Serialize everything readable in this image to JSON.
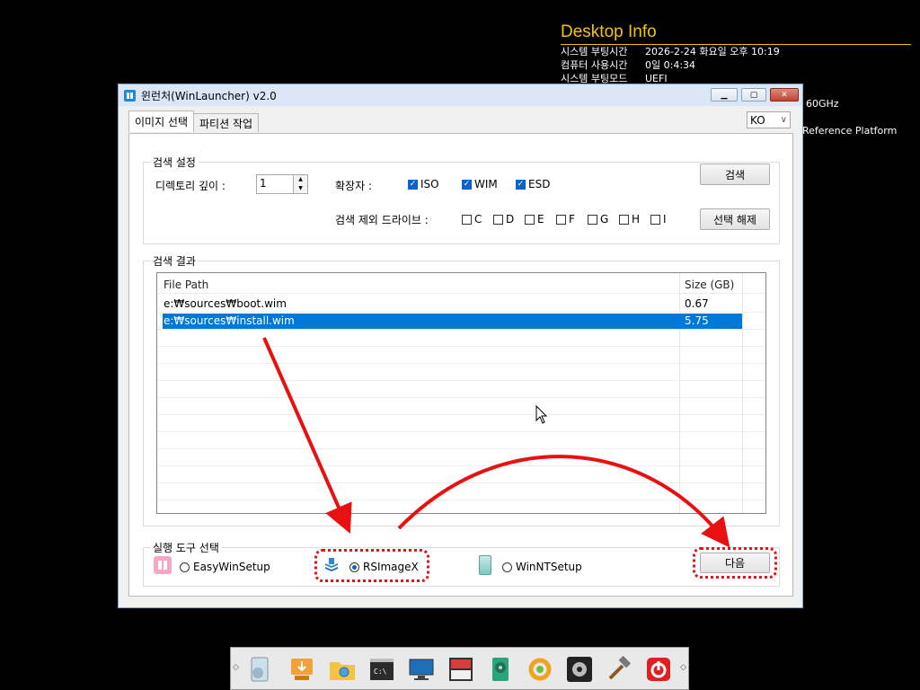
{
  "desktop_info": {
    "title": "Desktop Info",
    "rows": [
      {
        "key": "시스템 부팅시간",
        "value": "2026-2-24 화요일 오후 10:19"
      },
      {
        "key": "컴퓨터 사용시간",
        "value": "0일 0:4:34"
      },
      {
        "key": "시스템 부팅모드",
        "value": "UEFI"
      }
    ],
    "extra1": "60GHz",
    "extra2": "Reference Platform"
  },
  "window": {
    "title": "윈런처(WinLauncher) v2.0",
    "minimize": "▁",
    "maximize": "▢",
    "close": "✕"
  },
  "tabs": [
    {
      "label": "이미지 선택",
      "active": true
    },
    {
      "label": "파티션 작업",
      "active": false
    }
  ],
  "language": {
    "selected": "KO",
    "chevron": "∨"
  },
  "search": {
    "group_title": "검색 설정",
    "depth_label": "디렉토리 깊이 :",
    "depth_value": "1",
    "ext_label": "확장자 :",
    "extensions": [
      {
        "label": "ISO",
        "checked": true
      },
      {
        "label": "WIM",
        "checked": true
      },
      {
        "label": "ESD",
        "checked": true
      }
    ],
    "exclude_label": "검색 제외 드라이브 :",
    "drives": [
      "C",
      "D",
      "E",
      "F",
      "G",
      "H",
      "I"
    ],
    "search_button": "검색",
    "deselect_button": "선택 해제"
  },
  "results": {
    "group_title": "검색 결과",
    "columns": [
      "File Path",
      "Size (GB)"
    ],
    "rows": [
      {
        "path": "e:₩sources₩boot.wim",
        "size": "0.67",
        "selected": false
      },
      {
        "path": "e:₩sources₩install.wim",
        "size": "5.75",
        "selected": true
      }
    ]
  },
  "run": {
    "group_title": "실행 도구 선택",
    "options": [
      {
        "label": "EasyWinSetup",
        "selected": false,
        "icon": "windows-logo-icon"
      },
      {
        "label": "RSImageX",
        "selected": true,
        "icon": "rsimagex-icon"
      },
      {
        "label": "WinNTSetup",
        "selected": false,
        "icon": "winntsetup-icon"
      }
    ],
    "next_button": "다음"
  },
  "taskbar": {
    "left_nub": "◇",
    "right_nub": "◇",
    "icons": [
      {
        "name": "setup-disc-icon",
        "color": "#9bb6c9"
      },
      {
        "name": "usb-installer-icon",
        "color": "#f2a23a"
      },
      {
        "name": "file-explorer-icon",
        "color": "#f5c242"
      },
      {
        "name": "command-prompt-icon",
        "color": "#2b2b2b"
      },
      {
        "name": "monitor-icon",
        "color": "#1f6fb8"
      },
      {
        "name": "disk-partition-icon",
        "color": "#d83c3c"
      },
      {
        "name": "hard-drive-icon",
        "color": "#2aa47a"
      },
      {
        "name": "sync-icon",
        "color": "#f0a31e"
      },
      {
        "name": "settings-gear-icon",
        "color": "#444444"
      },
      {
        "name": "tools-hammer-icon",
        "color": "#777777"
      },
      {
        "name": "power-icon",
        "color": "#e02020"
      }
    ]
  },
  "colors": {
    "accent": "#0078d7",
    "annotation": "#e81010",
    "desktop_title": "#f5c400"
  }
}
